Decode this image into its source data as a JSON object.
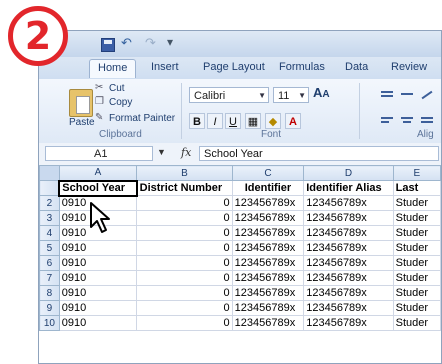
{
  "step_badge": "2",
  "ribbon": {
    "tabs": [
      "Home",
      "Insert",
      "Page Layout",
      "Formulas",
      "Data",
      "Review"
    ],
    "clipboard": {
      "cut": "Cut",
      "copy": "Copy",
      "paste": "Paste",
      "format_painter": "Format Painter",
      "group_label": "Clipboard"
    },
    "font": {
      "family": "Calibri",
      "size": "11",
      "grow": "A",
      "shrink": "A",
      "bold": "B",
      "italic": "I",
      "underline": "U",
      "font_color": "A",
      "group_label": "Font"
    },
    "alignment_label_partial": "Alig"
  },
  "formula_bar": {
    "name_box": "A1",
    "fx": "fx",
    "content": "School Year"
  },
  "sheet": {
    "columns": [
      "A",
      "B",
      "C",
      "D",
      "E"
    ],
    "header_row": [
      "School Year",
      "District Number",
      "Identifier",
      "Identifier Alias",
      "Last"
    ],
    "rows": [
      {
        "n": "2",
        "cells": [
          "0910",
          "0",
          "123456789x",
          "123456789x",
          "Studer"
        ]
      },
      {
        "n": "3",
        "cells": [
          "0910",
          "0",
          "123456789x",
          "123456789x",
          "Studer"
        ]
      },
      {
        "n": "4",
        "cells": [
          "0910",
          "0",
          "123456789x",
          "123456789x",
          "Studer"
        ]
      },
      {
        "n": "5",
        "cells": [
          "0910",
          "0",
          "123456789x",
          "123456789x",
          "Studer"
        ]
      },
      {
        "n": "6",
        "cells": [
          "0910",
          "0",
          "123456789x",
          "123456789x",
          "Studer"
        ]
      },
      {
        "n": "7",
        "cells": [
          "0910",
          "0",
          "123456789x",
          "123456789x",
          "Studer"
        ]
      },
      {
        "n": "8",
        "cells": [
          "0910",
          "0",
          "123456789x",
          "123456789x",
          "Studer"
        ]
      },
      {
        "n": "9",
        "cells": [
          "0910",
          "0",
          "123456789x",
          "123456789x",
          "Studer"
        ]
      },
      {
        "n": "10",
        "cells": [
          "0910",
          "0",
          "123456789x",
          "123456789x",
          "Studer"
        ]
      }
    ]
  },
  "colors": {
    "badge_red": "#e2262b",
    "ribbon_blue": "#dfe9f6",
    "text_blue": "#1f3e6e"
  }
}
